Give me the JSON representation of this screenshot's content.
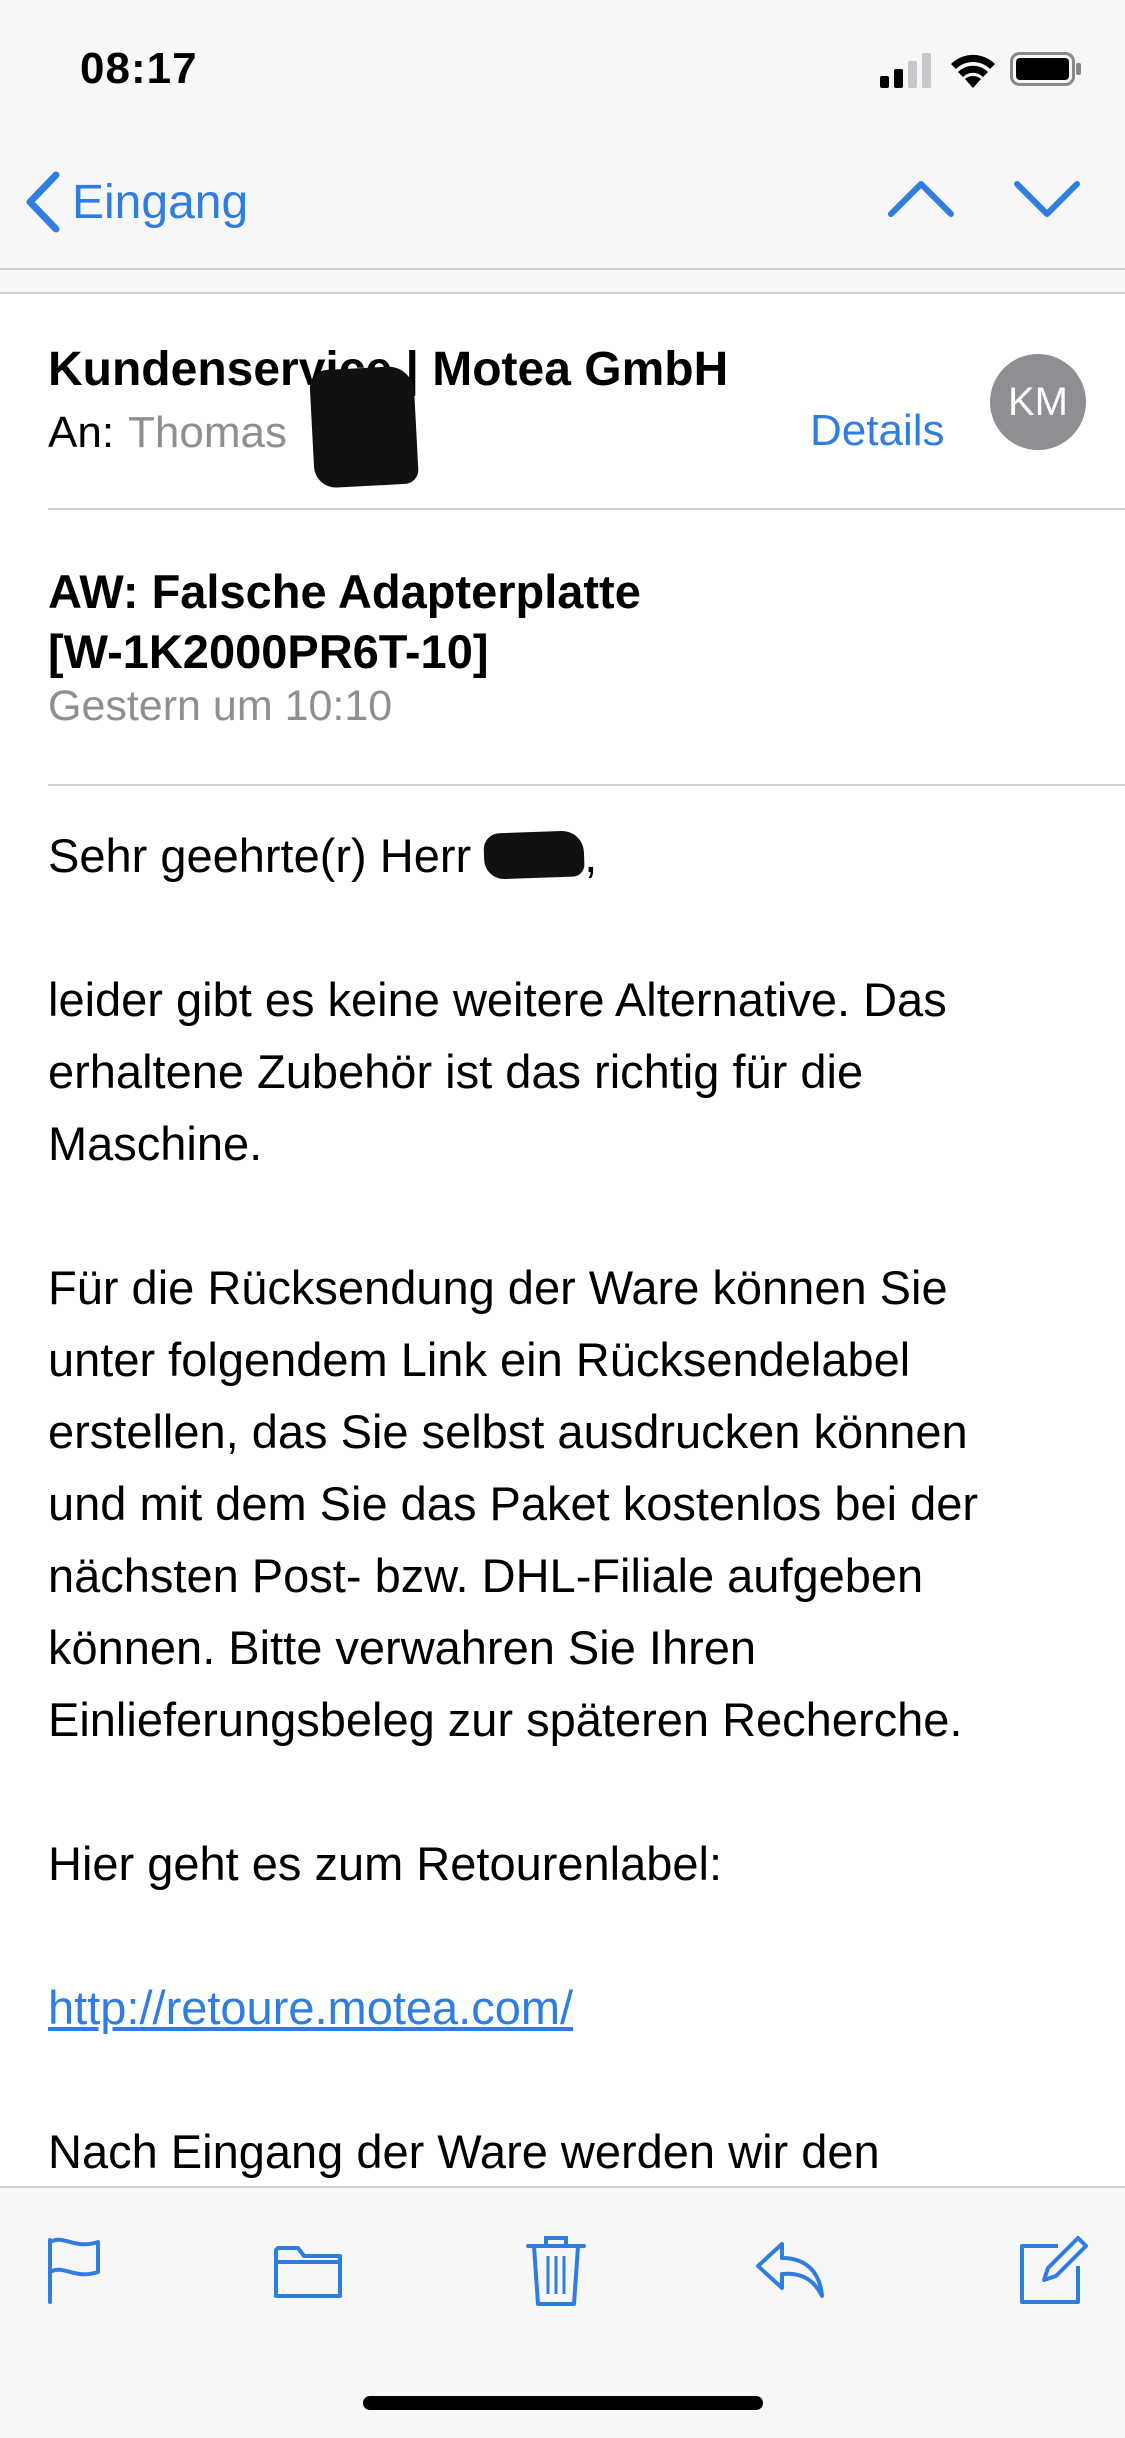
{
  "status_bar": {
    "time": "08:17",
    "icons": [
      "signal-icon",
      "wifi-icon",
      "battery-icon"
    ]
  },
  "nav": {
    "back_label": "Eingang",
    "icons": [
      "chevron-left-icon",
      "chevron-up-icon",
      "chevron-down-icon"
    ]
  },
  "email": {
    "sender": "Kundenservice | Motea GmbH",
    "to_label": "An:",
    "to_name": "Thomas",
    "details_label": "Details",
    "avatar_initials": "KM",
    "subject_line1": "AW: Falsche Adapterplatte",
    "subject_line2": "[W-1K2000PR6T-10]",
    "date": "Gestern um 10:10",
    "body": {
      "greeting": "Sehr geehrte(r) Herr",
      "greeting_comma": ",",
      "p1": [
        "leider gibt es keine weitere Alternative. Das",
        "erhaltene Zubehör ist das richtig für die",
        "Maschine."
      ],
      "p2": [
        "Für die Rücksendung der Ware können Sie",
        "unter folgendem Link ein Rücksendelabel",
        "erstellen, das Sie selbst ausdrucken können",
        "und mit dem Sie das Paket kostenlos bei der",
        "nächsten Post- bzw. DHL-Filiale aufgeben",
        "können. Bitte verwahren Sie Ihren",
        "Einlieferungsbeleg zur späteren Recherche."
      ],
      "p3": "Hier geht es zum Retourenlabel:",
      "link": "http://retoure.motea.com/",
      "p4": "Nach Eingang der Ware werden wir den"
    }
  },
  "toolbar": {
    "icons": [
      "flag-icon",
      "folder-icon",
      "trash-icon",
      "reply-icon",
      "compose-icon"
    ]
  },
  "colors": {
    "accent": "#2f7de1",
    "secondary_text": "#8e8e93",
    "bar_background": "#f7f7f8",
    "separator": "#d1d1d6"
  }
}
